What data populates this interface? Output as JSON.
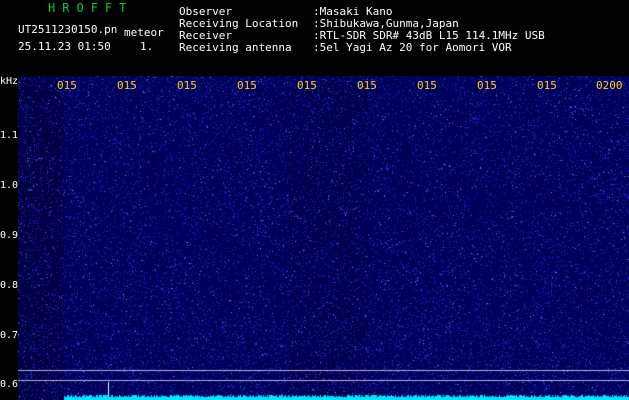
{
  "header": {
    "title": "HROFFT",
    "filename": "UT2511230150.pn",
    "mode": "meteor",
    "datetime": "25.11.23 01:50",
    "count": "1.",
    "observer_label": "Observer",
    "observer_value": ":Masaki Kano",
    "location_label": "Receiving Location",
    "location_value": ":Shibukawa,Gunma,Japan",
    "receiver_label": "Receiver",
    "receiver_value": ":RTL-SDR SDR# 43dB L15 114.1MHz USB",
    "antenna_label": "Receiving antenna",
    "antenna_value": ":5el Yagi Az 20 for Aomori VOR"
  },
  "axis": {
    "unit": "kHz",
    "y_ticks": [
      "1.1",
      "1.0",
      "0.9",
      "0.8",
      "0.7",
      "0.6"
    ],
    "x_ticks": [
      "015",
      "015",
      "015",
      "015",
      "015",
      "015",
      "015",
      "015",
      "015",
      "0200"
    ]
  },
  "colors": {
    "title": "#00cc33",
    "spectrum_base": "#000080",
    "noise_dot": "#3c3cff",
    "baseline": "#00e5ff",
    "tick_text": "#ffd21a"
  }
}
